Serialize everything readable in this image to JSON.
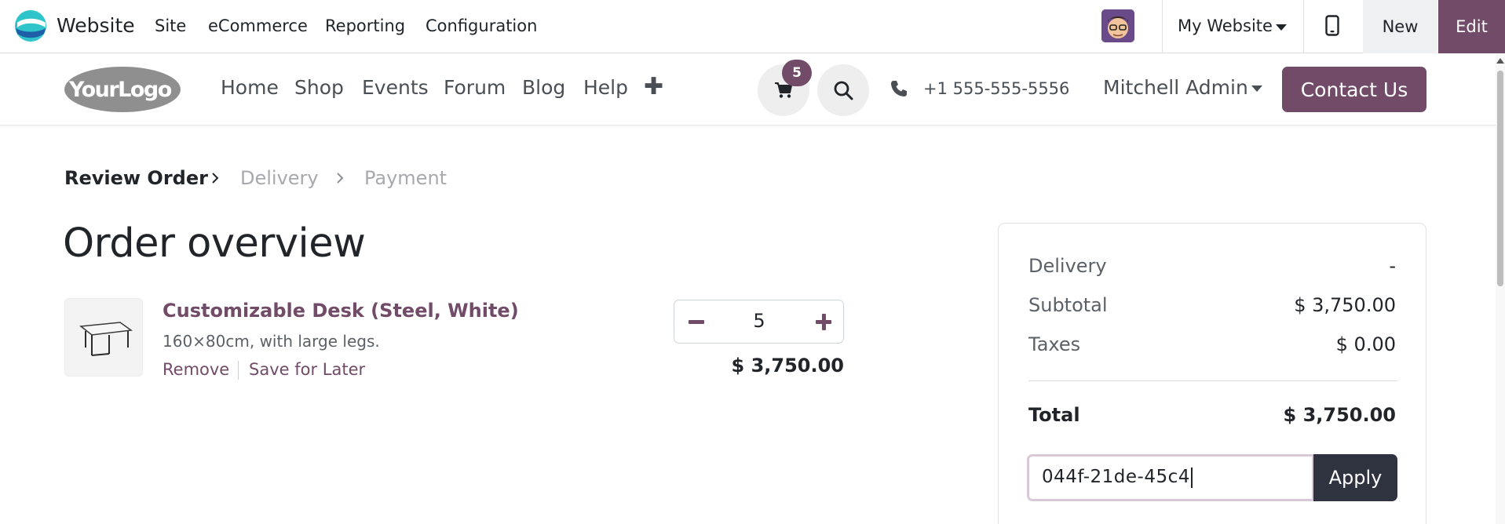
{
  "topbar": {
    "app_name": "Website",
    "menu": [
      "Site",
      "eCommerce",
      "Reporting",
      "Configuration"
    ],
    "website_switcher": "My Website",
    "new_label": "New",
    "edit_label": "Edit",
    "icons": [
      "odoo-logo-icon",
      "user-avatar",
      "caret-down-icon",
      "mobile-preview-icon"
    ]
  },
  "header": {
    "logo_text": "YourLogo",
    "nav": [
      "Home",
      "Shop",
      "Events",
      "Forum",
      "Blog",
      "Help"
    ],
    "add_icon": "plus-icon",
    "cart_count": "5",
    "phone": "+1 555-555-5556",
    "user": "Mitchell Admin",
    "contact_label": "Contact Us",
    "accent": "#714b67"
  },
  "breadcrumb": {
    "steps": [
      "Review Order",
      "Delivery",
      "Payment"
    ],
    "active_index": 0
  },
  "order": {
    "title": "Order overview",
    "product": {
      "name": "Customizable Desk (Steel, White)",
      "description": "160×80cm, with large legs.",
      "remove_label": "Remove",
      "save_label": "Save for Later",
      "quantity": "5",
      "price": "$ 3,750.00"
    }
  },
  "summary": {
    "rows": [
      {
        "label": "Delivery",
        "value": "-"
      },
      {
        "label": "Subtotal",
        "value": "$ 3,750.00"
      },
      {
        "label": "Taxes",
        "value": "$ 0.00"
      }
    ],
    "total_label": "Total",
    "total_value": "$ 3,750.00",
    "promo_value": "044f-21de-45c4",
    "apply_label": "Apply"
  }
}
